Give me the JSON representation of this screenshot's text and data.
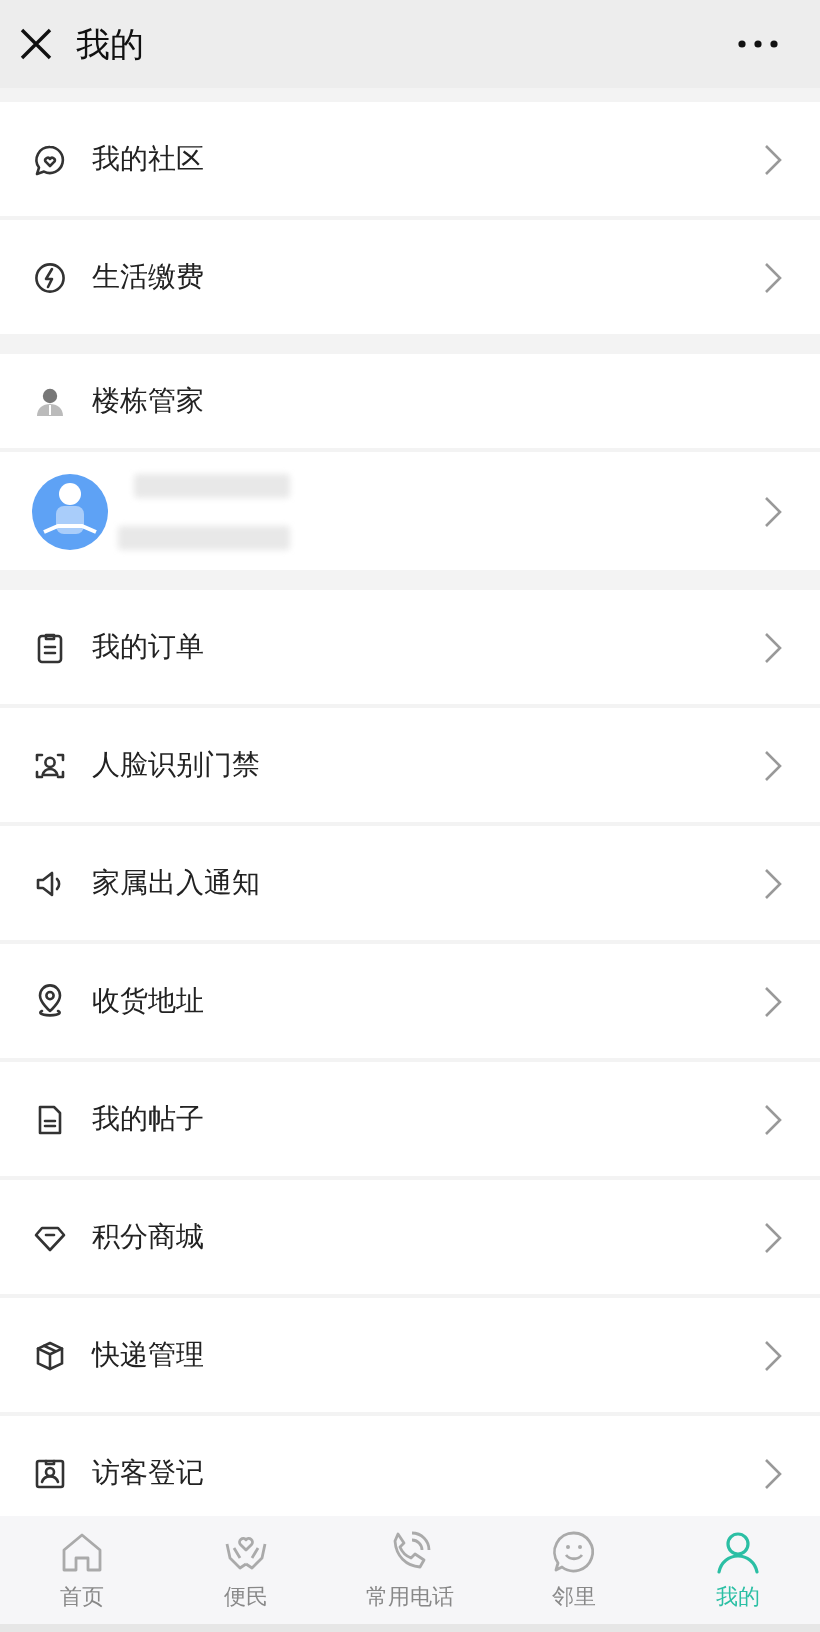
{
  "header": {
    "title": "我的"
  },
  "groups": [
    {
      "items": [
        {
          "kind": "link",
          "label": "我的社区"
        },
        {
          "kind": "link",
          "label": "生活缴费"
        }
      ]
    },
    {
      "items": [
        {
          "kind": "header",
          "label": "楼栋管家"
        },
        {
          "kind": "profile"
        }
      ]
    },
    {
      "items": [
        {
          "kind": "link",
          "label": "我的订单"
        },
        {
          "kind": "link",
          "label": "人脸识别门禁"
        },
        {
          "kind": "link",
          "label": "家属出入通知"
        },
        {
          "kind": "link",
          "label": "收货地址"
        },
        {
          "kind": "link",
          "label": "我的帖子"
        },
        {
          "kind": "link",
          "label": "积分商城"
        },
        {
          "kind": "link",
          "label": "快递管理"
        },
        {
          "kind": "link",
          "label": "访客登记"
        }
      ]
    }
  ],
  "tabs": [
    {
      "label": "首页",
      "selected": false
    },
    {
      "label": "便民",
      "selected": false
    },
    {
      "label": "常用电话",
      "selected": false
    },
    {
      "label": "邻里",
      "selected": false
    },
    {
      "label": "我的",
      "selected": true
    }
  ]
}
